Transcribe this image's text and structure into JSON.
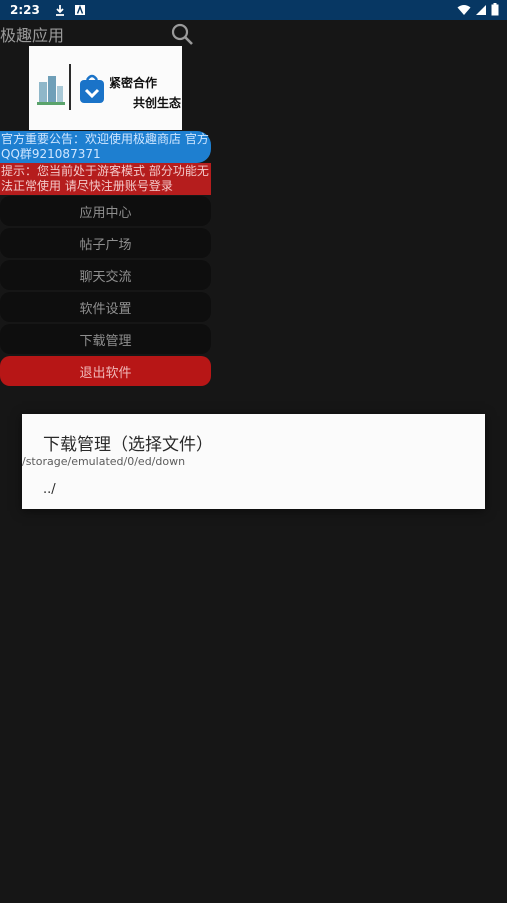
{
  "status_bar": {
    "time": "2:23",
    "icons": [
      "download-icon",
      "a-icon",
      "wifi-icon",
      "signal-icon",
      "battery-icon"
    ]
  },
  "app": {
    "title": "极趣应用",
    "search_icon": "search-icon"
  },
  "banner": {
    "line1": "紧密合作",
    "line2": "共创生态"
  },
  "notice": "官方重要公告：欢迎使用极趣商店 官方QQ群921087371",
  "tip": "提示：您当前处于游客模式 部分功能无法正常使用 请尽快注册账号登录",
  "menu": [
    {
      "label": "应用中心"
    },
    {
      "label": "帖子广场"
    },
    {
      "label": "聊天交流"
    },
    {
      "label": "软件设置"
    },
    {
      "label": "下载管理"
    },
    {
      "label": "退出软件"
    }
  ],
  "dialog": {
    "title": "下载管理（选择文件）",
    "path": "/storage/emulated/0/ed/down",
    "entries": [
      "../"
    ]
  },
  "colors": {
    "status_bar": "#073763",
    "background": "#161616",
    "notice": "#1e7fd0",
    "tip": "#b51d1d",
    "exit": "#b71616"
  }
}
